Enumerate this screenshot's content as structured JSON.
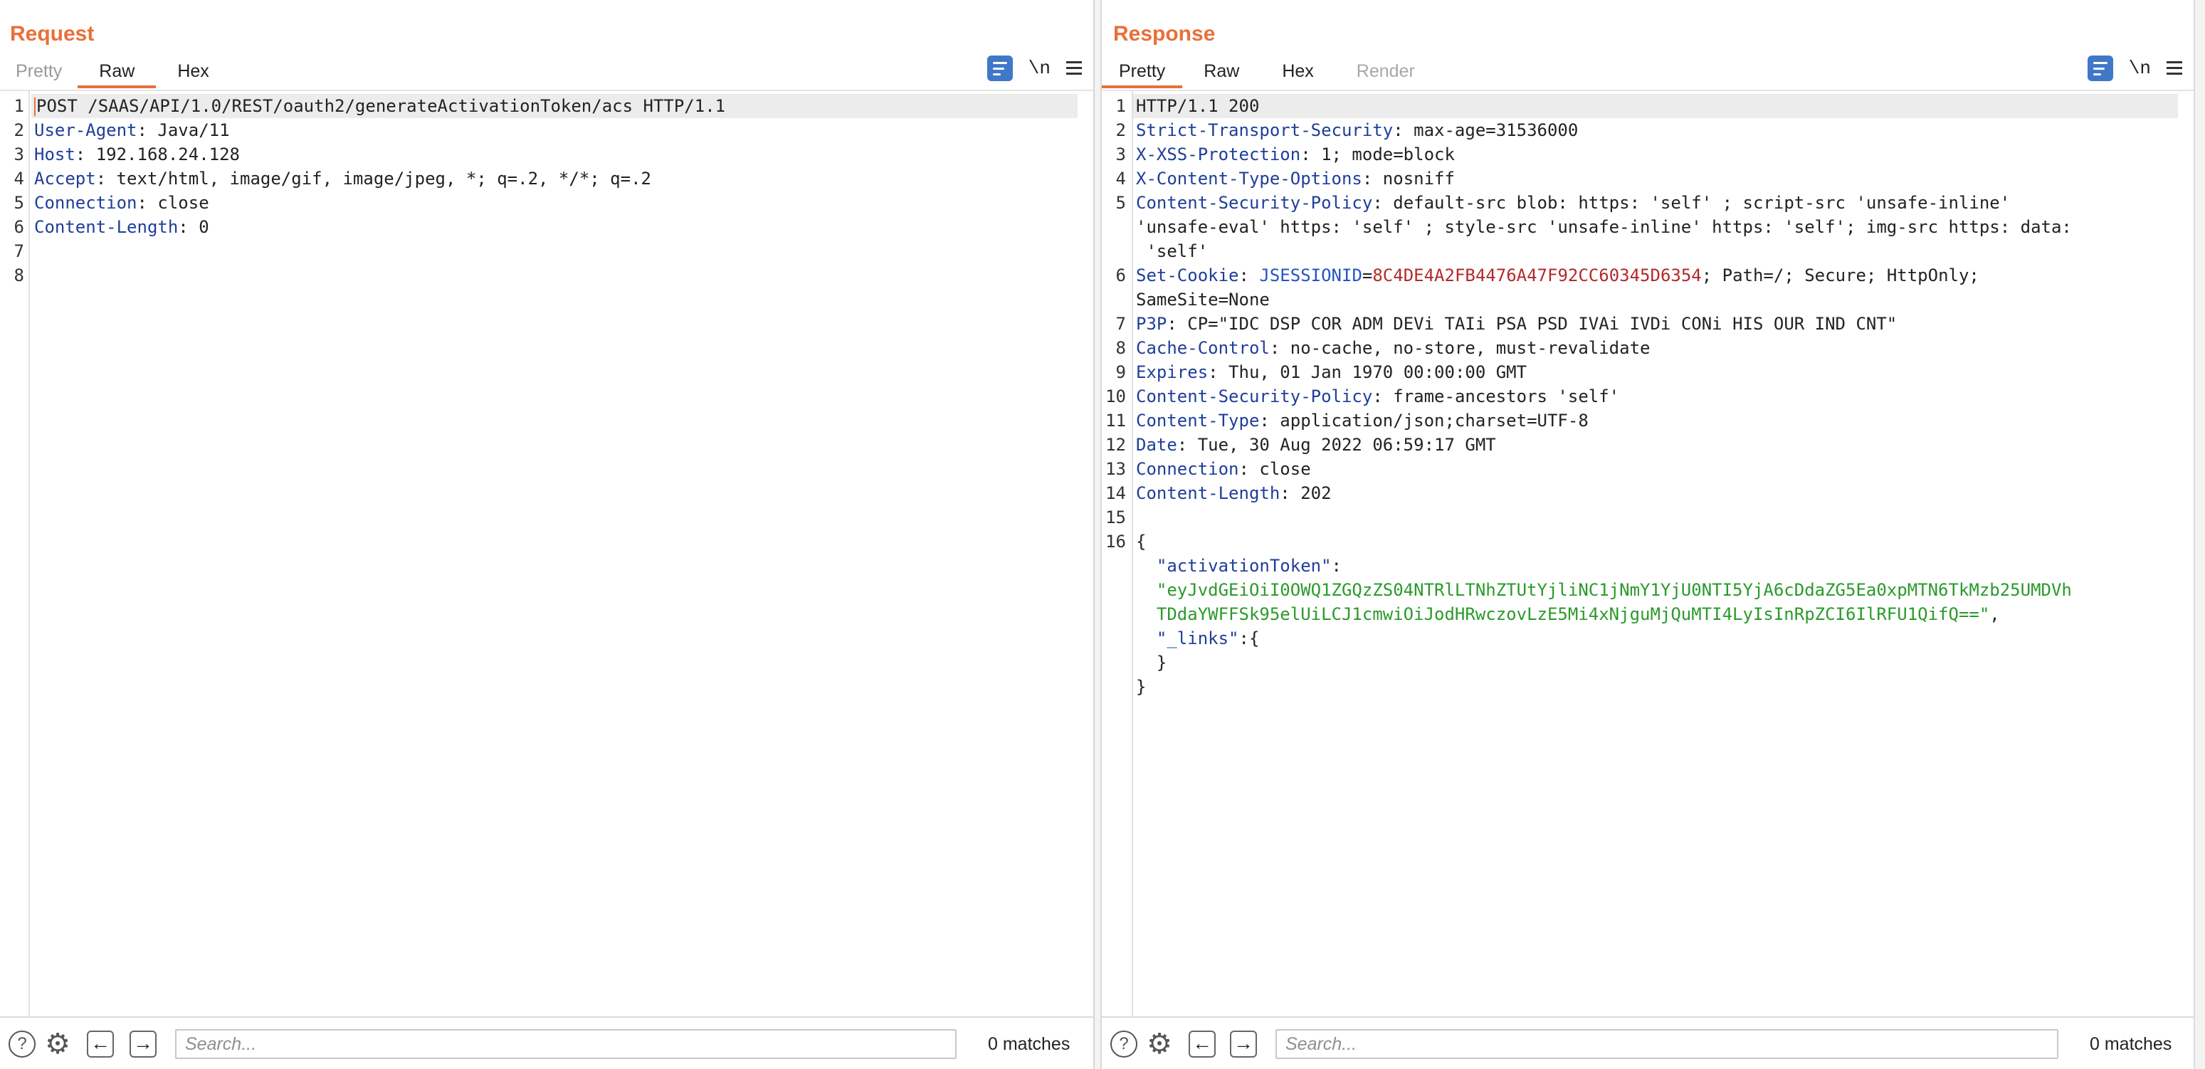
{
  "request": {
    "title": "Request",
    "tabs": [
      "Pretty",
      "Raw",
      "Hex"
    ],
    "active_tab": "Raw",
    "lines": [
      {
        "n": "1",
        "parts": [
          {
            "t": "POST /SAAS/API/1.0/REST/oauth2/generateActivationToken/acs HTTP/1.1",
            "c": "val"
          }
        ]
      },
      {
        "n": "2",
        "parts": [
          {
            "t": "User-Agent",
            "c": "key"
          },
          {
            "t": ": Java/11",
            "c": "val"
          }
        ]
      },
      {
        "n": "3",
        "parts": [
          {
            "t": "Host",
            "c": "key"
          },
          {
            "t": ": 192.168.24.128",
            "c": "val"
          }
        ]
      },
      {
        "n": "4",
        "parts": [
          {
            "t": "Accept",
            "c": "key"
          },
          {
            "t": ": text/html, image/gif, image/jpeg, *; q=.2, */*; q=.2",
            "c": "val"
          }
        ]
      },
      {
        "n": "5",
        "parts": [
          {
            "t": "Connection",
            "c": "key"
          },
          {
            "t": ": close",
            "c": "val"
          }
        ]
      },
      {
        "n": "6",
        "parts": [
          {
            "t": "Content-Length",
            "c": "key"
          },
          {
            "t": ": 0",
            "c": "val"
          }
        ]
      },
      {
        "n": "7",
        "parts": []
      },
      {
        "n": "8",
        "parts": []
      }
    ],
    "search_placeholder": "Search...",
    "matches": "0 matches"
  },
  "response": {
    "title": "Response",
    "tabs": [
      "Pretty",
      "Raw",
      "Hex",
      "Render"
    ],
    "active_tab": "Pretty",
    "lines": [
      {
        "n": "1",
        "parts": [
          {
            "t": "HTTP/1.1 200",
            "c": "val"
          }
        ]
      },
      {
        "n": "2",
        "parts": [
          {
            "t": "Strict-Transport-Security",
            "c": "key"
          },
          {
            "t": ": max-age=31536000",
            "c": "val"
          }
        ]
      },
      {
        "n": "3",
        "parts": [
          {
            "t": "X-XSS-Protection",
            "c": "key"
          },
          {
            "t": ": 1; mode=block",
            "c": "val"
          }
        ]
      },
      {
        "n": "4",
        "parts": [
          {
            "t": "X-Content-Type-Options",
            "c": "key"
          },
          {
            "t": ": nosniff",
            "c": "val"
          }
        ]
      },
      {
        "n": "5",
        "parts": [
          {
            "t": "Content-Security-Policy",
            "c": "key"
          },
          {
            "t": ": default-src blob: https: 'self' ; script-src 'unsafe-inline'",
            "c": "val"
          }
        ]
      },
      {
        "n": "",
        "parts": [
          {
            "t": "'unsafe-eval' https: 'self' ; style-src 'unsafe-inline' https: 'self'; img-src https: data:",
            "c": "val"
          }
        ]
      },
      {
        "n": "",
        "parts": [
          {
            "t": " 'self'",
            "c": "val"
          }
        ]
      },
      {
        "n": "6",
        "parts": [
          {
            "t": "Set-Cookie",
            "c": "key"
          },
          {
            "t": ": ",
            "c": "val"
          },
          {
            "t": "JSESSIONID",
            "c": "cookie-name"
          },
          {
            "t": "=",
            "c": "val"
          },
          {
            "t": "8C4DE4A2FB4476A47F92CC60345D6354",
            "c": "cookie-val"
          },
          {
            "t": "; Path=/; Secure; HttpOnly;",
            "c": "val"
          }
        ]
      },
      {
        "n": "",
        "parts": [
          {
            "t": "SameSite=None",
            "c": "val"
          }
        ]
      },
      {
        "n": "7",
        "parts": [
          {
            "t": "P3P",
            "c": "key"
          },
          {
            "t": ": CP=\"IDC DSP COR ADM DEVi TAIi PSA PSD IVAi IVDi CONi HIS OUR IND CNT\"",
            "c": "val"
          }
        ]
      },
      {
        "n": "8",
        "parts": [
          {
            "t": "Cache-Control",
            "c": "key"
          },
          {
            "t": ": no-cache, no-store, must-revalidate",
            "c": "val"
          }
        ]
      },
      {
        "n": "9",
        "parts": [
          {
            "t": "Expires",
            "c": "key"
          },
          {
            "t": ": Thu, 01 Jan 1970 00:00:00 GMT",
            "c": "val"
          }
        ]
      },
      {
        "n": "10",
        "parts": [
          {
            "t": "Content-Security-Policy",
            "c": "key"
          },
          {
            "t": ": frame-ancestors 'self'",
            "c": "val"
          }
        ]
      },
      {
        "n": "11",
        "parts": [
          {
            "t": "Content-Type",
            "c": "key"
          },
          {
            "t": ": application/json;charset=UTF-8",
            "c": "val"
          }
        ]
      },
      {
        "n": "12",
        "parts": [
          {
            "t": "Date",
            "c": "key"
          },
          {
            "t": ": Tue, 30 Aug 2022 06:59:17 GMT",
            "c": "val"
          }
        ]
      },
      {
        "n": "13",
        "parts": [
          {
            "t": "Connection",
            "c": "key"
          },
          {
            "t": ": close",
            "c": "val"
          }
        ]
      },
      {
        "n": "14",
        "parts": [
          {
            "t": "Content-Length",
            "c": "key"
          },
          {
            "t": ": 202",
            "c": "val"
          }
        ]
      },
      {
        "n": "15",
        "parts": []
      },
      {
        "n": "16",
        "parts": [
          {
            "t": "{",
            "c": "val"
          }
        ]
      },
      {
        "n": "",
        "parts": [
          {
            "t": "  \"activationToken\"",
            "c": "key"
          },
          {
            "t": ":",
            "c": "val"
          }
        ]
      },
      {
        "n": "",
        "parts": [
          {
            "t": "  \"eyJvdGEiOiI0OWQ1ZGQzZS04NTRlLTNhZTUtYjliNC1jNmY1YjU0NTI5YjA6cDdaZG5Ea0xpMTN6TkMzb25UMDVh",
            "c": "json-str"
          }
        ]
      },
      {
        "n": "",
        "parts": [
          {
            "t": "  TDdaYWFFSk95elUiLCJ1cmwiOiJodHRwczovLzE5Mi4xNjguMjQuMTI4LyIsInRpZCI6IlRFU1QifQ==\"",
            "c": "json-str"
          },
          {
            "t": ",",
            "c": "val"
          }
        ]
      },
      {
        "n": "",
        "parts": [
          {
            "t": "  \"_links\"",
            "c": "key"
          },
          {
            "t": ":{",
            "c": "val"
          }
        ]
      },
      {
        "n": "",
        "parts": [
          {
            "t": "  }",
            "c": "val"
          }
        ]
      },
      {
        "n": "",
        "parts": [
          {
            "t": "}",
            "c": "val"
          }
        ]
      }
    ],
    "search_placeholder": "Search...",
    "matches": "0 matches"
  },
  "toolbar": {
    "newline_label": "\\n"
  },
  "icons": {
    "wrap": "text-wrap-icon",
    "menu": "menu-icon",
    "help": "help-icon",
    "settings": "gear-icon",
    "back": "arrow-left-icon",
    "forward": "arrow-right-icon"
  },
  "colors": {
    "accent": "#e8703a",
    "header_key": "#1f3e9a",
    "json_string": "#2b9a2b",
    "cookie_value": "#b4292b",
    "button_blue": "#3f78c9"
  }
}
